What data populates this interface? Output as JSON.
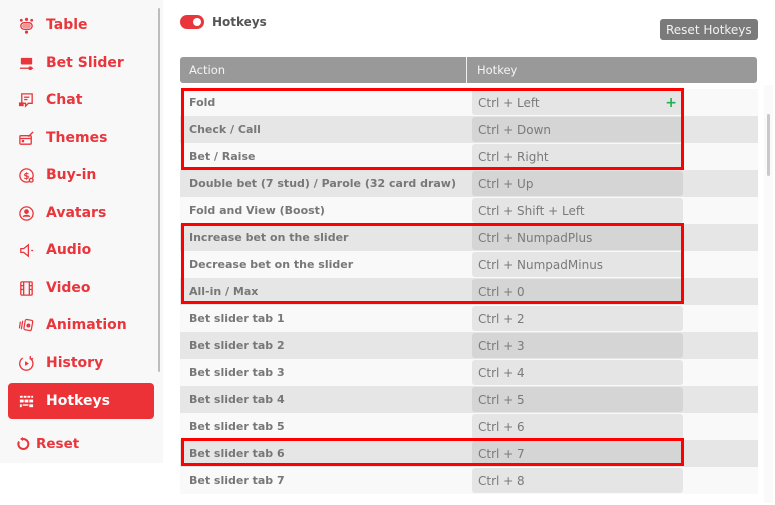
{
  "sidebar": {
    "items": [
      {
        "label": "Table",
        "icon": "poker-table-icon",
        "active": false
      },
      {
        "label": "Bet Slider",
        "icon": "bet-slider-icon",
        "active": false
      },
      {
        "label": "Chat",
        "icon": "chat-icon",
        "active": false
      },
      {
        "label": "Themes",
        "icon": "themes-icon",
        "active": false
      },
      {
        "label": "Buy-in",
        "icon": "buy-in-icon",
        "active": false
      },
      {
        "label": "Avatars",
        "icon": "avatar-icon",
        "active": false
      },
      {
        "label": "Audio",
        "icon": "speaker-icon",
        "active": false
      },
      {
        "label": "Video",
        "icon": "film-icon",
        "active": false
      },
      {
        "label": "Animation",
        "icon": "animation-cards-icon",
        "active": false
      },
      {
        "label": "History",
        "icon": "history-replay-icon",
        "active": false
      },
      {
        "label": "Hotkeys",
        "icon": "keyboard-icon",
        "active": true
      }
    ],
    "reset_label": "Reset"
  },
  "toolbar": {
    "toggle_label": "Hotkeys",
    "toggle_on": true,
    "reset_hotkeys_label": "Reset Hotkeys"
  },
  "table": {
    "columns": [
      "Action",
      "Hotkey"
    ],
    "rows": [
      {
        "action": "Fold",
        "hotkey": "Ctrl + Left",
        "add_icon": "+"
      },
      {
        "action": "Check / Call",
        "hotkey": "Ctrl + Down"
      },
      {
        "action": "Bet / Raise",
        "hotkey": "Ctrl + Right"
      },
      {
        "action": "Double bet (7 stud) / Parole (32 card draw)",
        "hotkey": "Ctrl + Up"
      },
      {
        "action": "Fold and View (Boost)",
        "hotkey": "Ctrl + Shift + Left"
      },
      {
        "action": "Increase bet on the slider",
        "hotkey": "Ctrl + NumpadPlus"
      },
      {
        "action": "Decrease bet on the slider",
        "hotkey": "Ctrl + NumpadMinus"
      },
      {
        "action": "All-in / Max",
        "hotkey": "Ctrl + 0"
      },
      {
        "action": "Bet slider tab 1",
        "hotkey": "Ctrl + 2"
      },
      {
        "action": "Bet slider tab 2",
        "hotkey": "Ctrl + 3"
      },
      {
        "action": "Bet slider tab 3",
        "hotkey": "Ctrl + 4"
      },
      {
        "action": "Bet slider tab 4",
        "hotkey": "Ctrl + 5"
      },
      {
        "action": "Bet slider tab 5",
        "hotkey": "Ctrl + 6"
      },
      {
        "action": "Bet slider tab 6",
        "hotkey": "Ctrl + 7"
      },
      {
        "action": "Bet slider tab 7",
        "hotkey": "Ctrl + 8"
      }
    ]
  },
  "colors": {
    "accent": "#e8363c",
    "active_bg": "#ec3237",
    "highlight": "#ff0000",
    "add_icon": "#22b14c",
    "header_bg": "#999999",
    "reset_button_bg": "#7a7a7a"
  }
}
